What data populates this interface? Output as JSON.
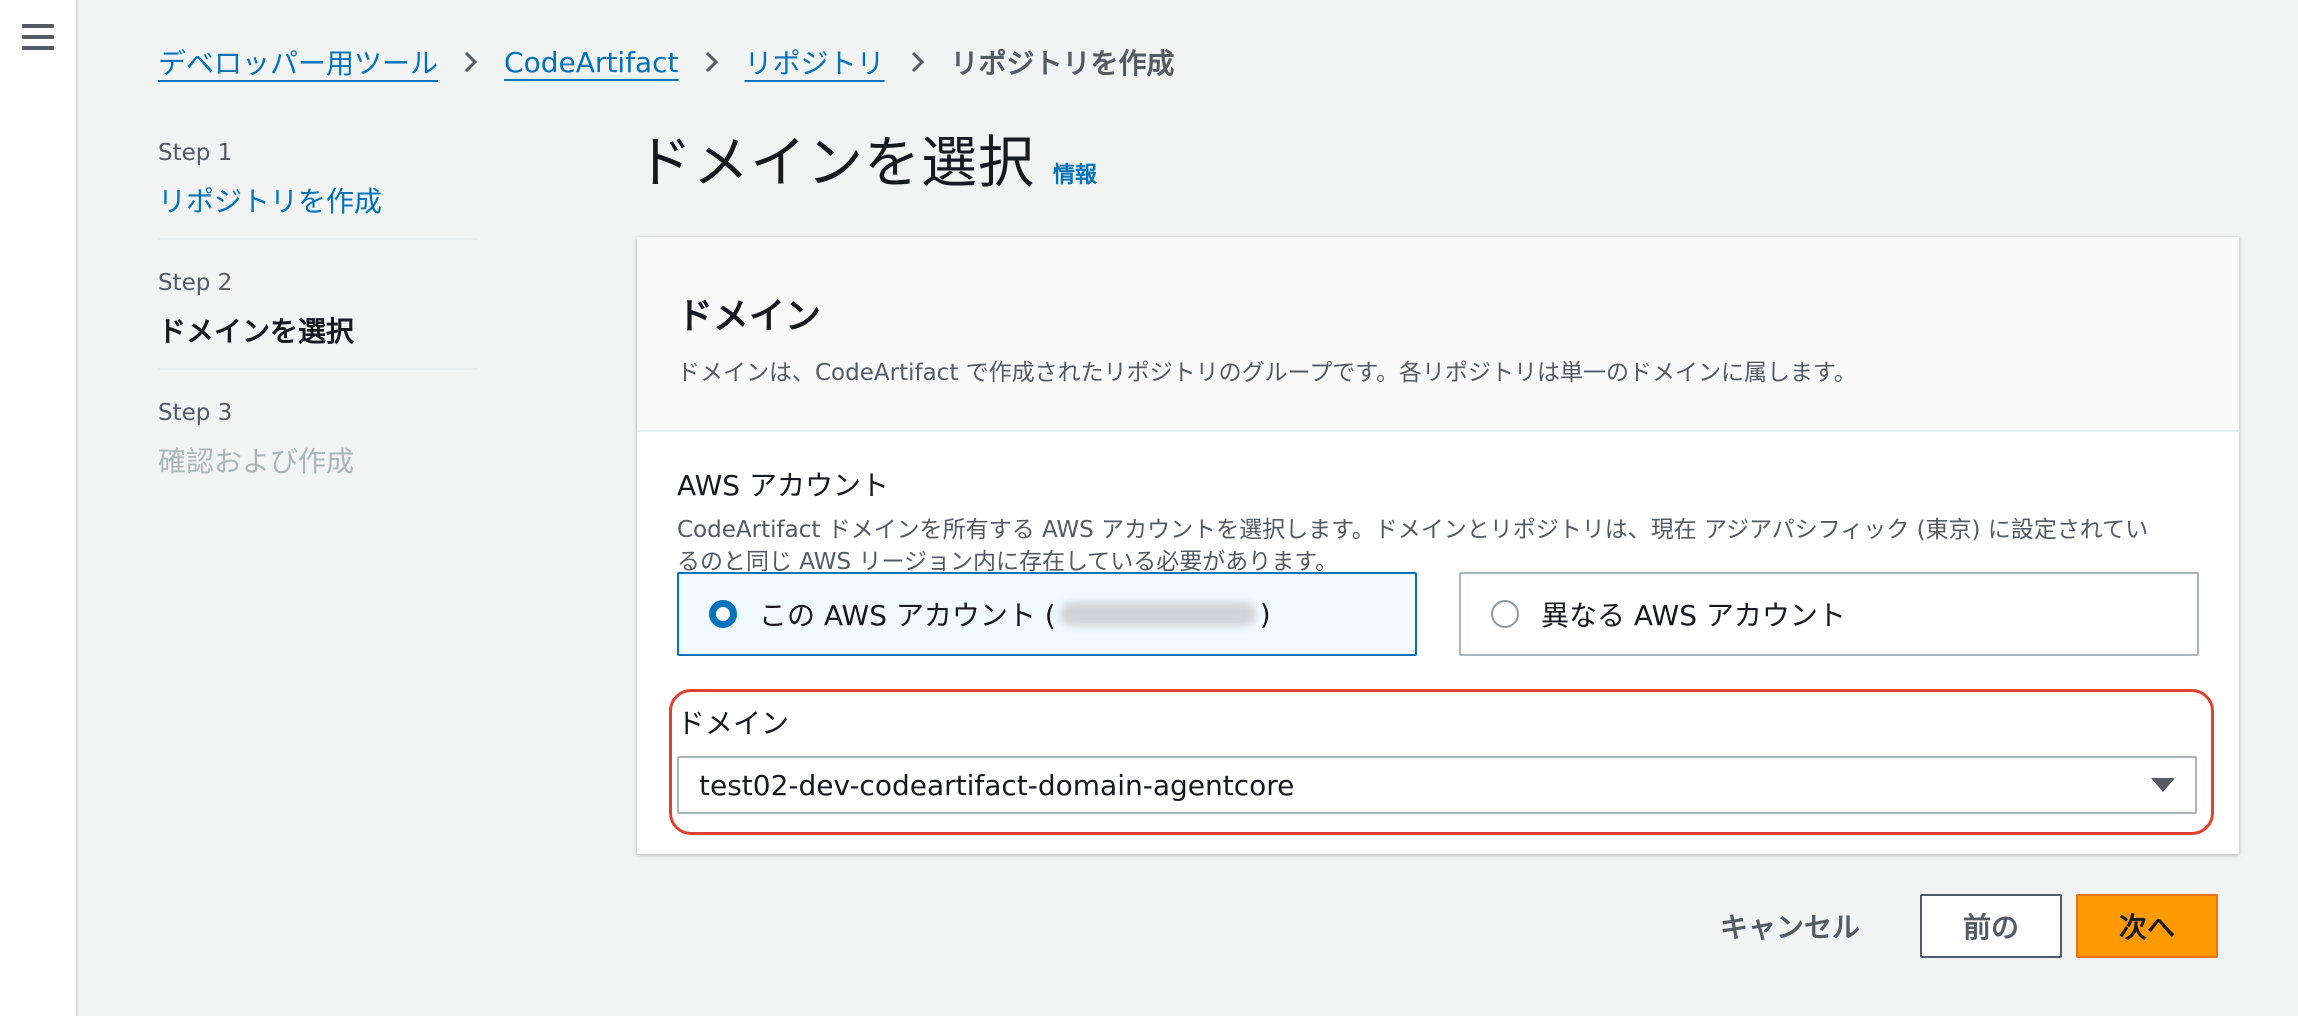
{
  "breadcrumb": {
    "items": [
      "デベロッパー用ツール",
      "CodeArtifact",
      "リポジトリ"
    ],
    "current": "リポジトリを作成"
  },
  "steps": [
    {
      "num": "Step 1",
      "title": "リポジトリを作成"
    },
    {
      "num": "Step 2",
      "title": "ドメインを選択"
    },
    {
      "num": "Step 3",
      "title": "確認および作成"
    }
  ],
  "page": {
    "title": "ドメインを選択",
    "info": "情報"
  },
  "container": {
    "title": "ドメイン",
    "description": "ドメインは、CodeArtifact で作成されたリポジトリのグループです。各リポジトリは単一のドメインに属します。"
  },
  "account": {
    "label": "AWS アカウント",
    "description_line1": "CodeArtifact ドメインを所有する AWS アカウントを選択します。ドメインとリポジトリは、現在 アジアパシフィック (東京) に設定されてい",
    "description_line2": "るのと同じ AWS リージョン内に存在している必要があります。",
    "options": [
      {
        "label_prefix": "この AWS アカウント (",
        "label_suffix": ")"
      },
      {
        "label": "異なる AWS アカウント"
      }
    ]
  },
  "domain": {
    "label": "ドメイン",
    "selected": "test02-dev-codeartifact-domain-agentcore"
  },
  "actions": {
    "cancel": "キャンセル",
    "previous": "前の",
    "next": "次へ"
  },
  "colors": {
    "accent": "#0073bb",
    "primary_button": "#ff9900",
    "highlight": "#e0412e"
  }
}
